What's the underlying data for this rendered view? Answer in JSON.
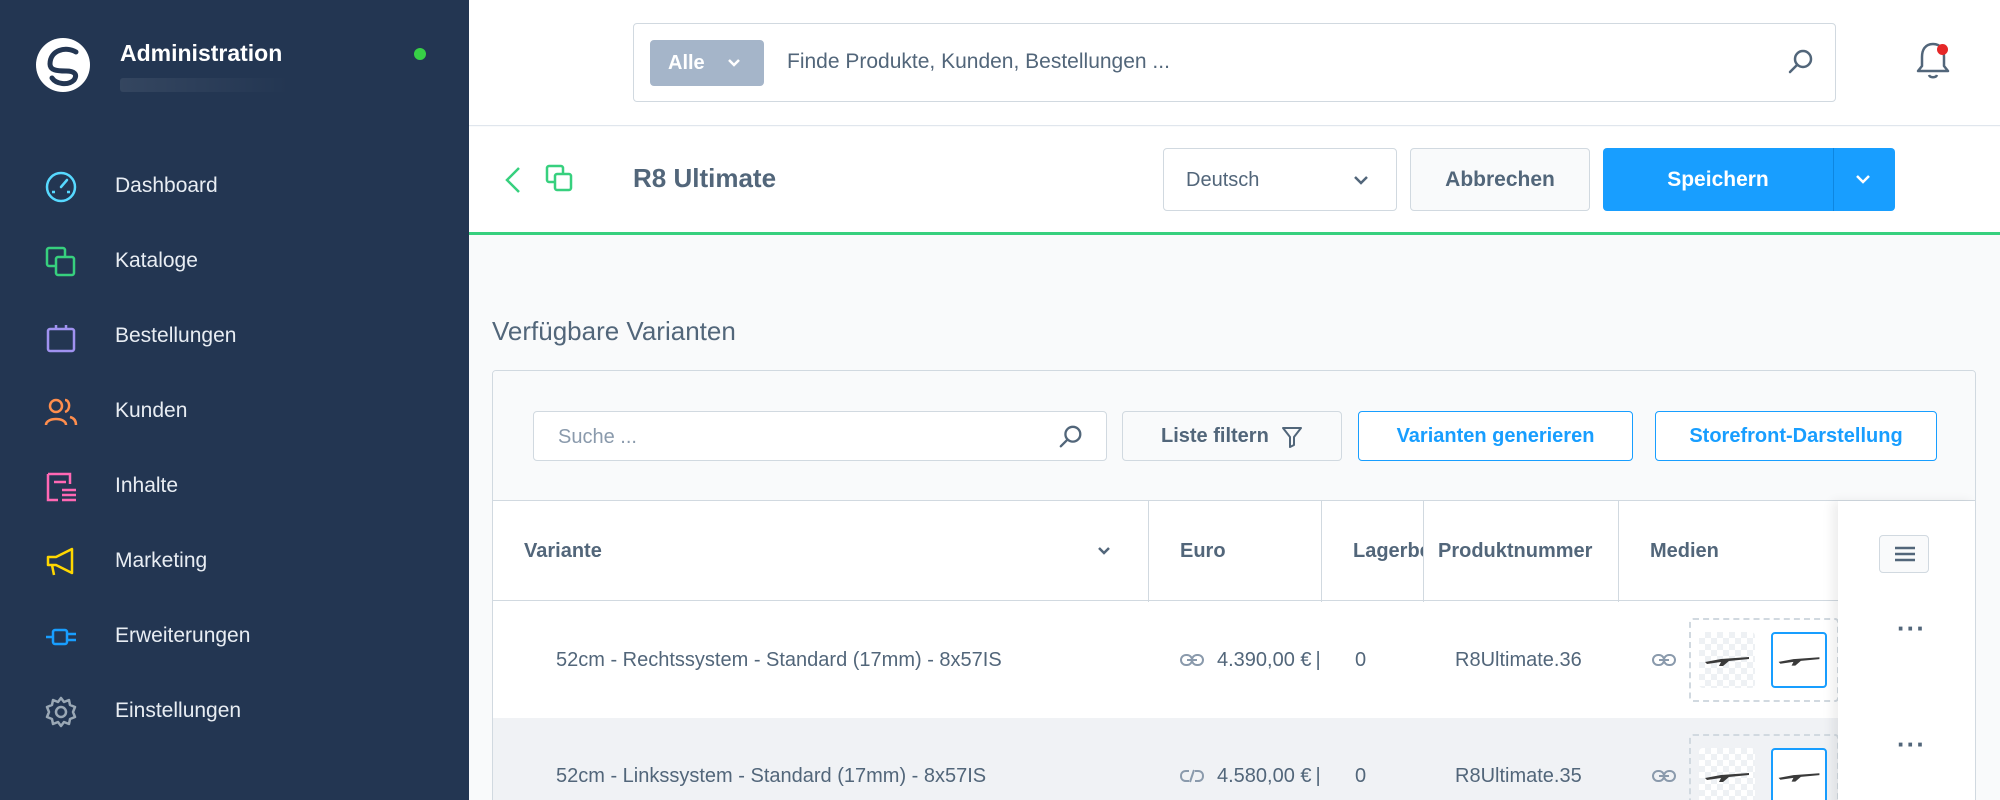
{
  "sidebar": {
    "title": "Administration",
    "items": [
      {
        "label": "Dashboard",
        "icon": "dashboard-gauge-icon",
        "color": "#57d9ff"
      },
      {
        "label": "Kataloge",
        "icon": "catalog-stack-icon",
        "color": "#37d07e"
      },
      {
        "label": "Bestellungen",
        "icon": "shopping-bag-icon",
        "color": "#a092f0"
      },
      {
        "label": "Kunden",
        "icon": "users-icon",
        "color": "#ff8e4d"
      },
      {
        "label": "Inhalte",
        "icon": "content-list-icon",
        "color": "#ff68b4"
      },
      {
        "label": "Marketing",
        "icon": "megaphone-icon",
        "color": "#ffd700"
      },
      {
        "label": "Erweiterungen",
        "icon": "plug-icon",
        "color": "#189eff"
      },
      {
        "label": "Einstellungen",
        "icon": "gear-icon",
        "color": "#9aa8b5"
      }
    ]
  },
  "search": {
    "scope": "Alle",
    "placeholder": "Finde Produkte, Kunden, Bestellungen ..."
  },
  "toolbar": {
    "title": "R8 Ultimate",
    "language": "Deutsch",
    "cancel_label": "Abbrechen",
    "save_label": "Speichern"
  },
  "variants": {
    "section_title": "Verfügbare Varianten",
    "search_placeholder": "Suche ...",
    "filter_label": "Liste filtern",
    "generate_label": "Varianten generieren",
    "storefront_label": "Storefront-Darstellung",
    "columns": [
      "Variante",
      "Euro",
      "Lagerbestand",
      "Produktnummer",
      "Medien"
    ],
    "rows": [
      {
        "variant": "52cm - Rechtssystem - Standard (17mm) - 8x57IS",
        "price": "4.390,00 €",
        "stock": "0",
        "number": "R8Ultimate.36",
        "price_linked": true
      },
      {
        "variant": "52cm - Linkssystem - Standard (17mm) - 8x57IS",
        "price": "4.580,00 €",
        "stock": "0",
        "number": "R8Ultimate.35",
        "price_linked": false
      }
    ]
  },
  "colors": {
    "sidebar_bg": "#233652",
    "primary": "#189eff",
    "success": "#37d07e",
    "text": "#52667a"
  }
}
